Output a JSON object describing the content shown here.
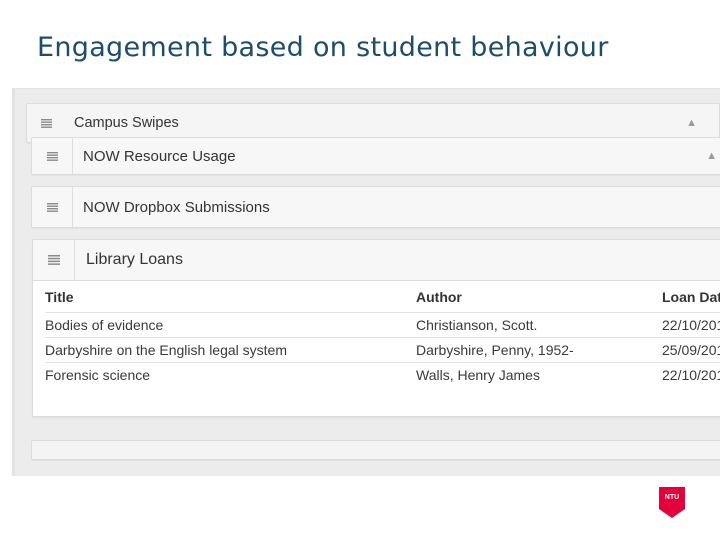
{
  "slide": {
    "title": "Engagement based on student behaviour"
  },
  "panels": {
    "campus_swipes": {
      "label": "Campus Swipes",
      "icon": "menu-icon",
      "chevron": "chevron-up-icon"
    },
    "resource_usage": {
      "label": "NOW Resource Usage",
      "icon": "menu-icon",
      "chevron": "chevron-up-icon"
    },
    "dropbox": {
      "label": "NOW Dropbox Submissions",
      "icon": "menu-icon"
    },
    "library": {
      "label": "Library Loans",
      "icon": "menu-icon",
      "columns": [
        "Title",
        "Author",
        "Loan Dat"
      ],
      "rows": [
        [
          "Bodies of evidence",
          "Christianson, Scott.",
          "22/10/201"
        ],
        [
          "Darbyshire on the English legal system",
          "Darbyshire, Penny, 1952-",
          "25/09/201"
        ],
        [
          "Forensic science",
          "Walls, Henry James",
          "22/10/201"
        ]
      ]
    }
  },
  "logo": {
    "text": "NTU",
    "color": "#e4003b"
  },
  "colors": {
    "title": "#1e4d6b",
    "background": "#ececec",
    "panel": "#f7f7f7"
  }
}
